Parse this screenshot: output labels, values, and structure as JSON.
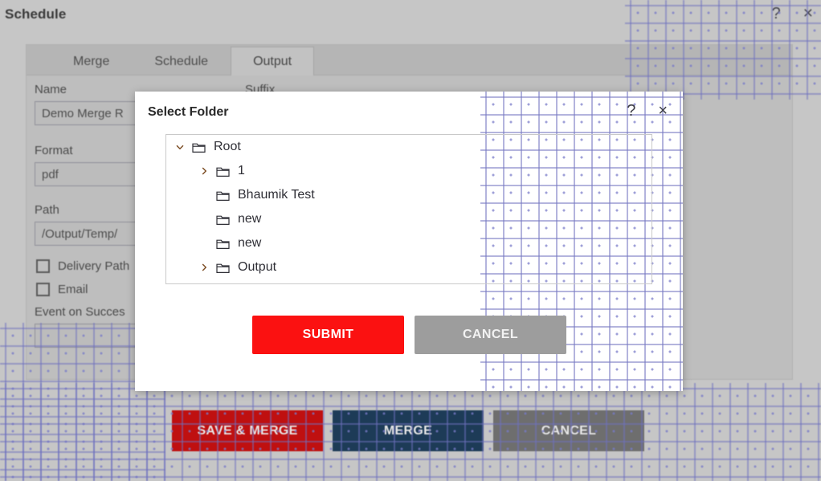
{
  "window": {
    "title": "Schedule",
    "help_icon": "?",
    "close_icon": "×"
  },
  "tabs": [
    {
      "label": "Merge",
      "active": false
    },
    {
      "label": "Schedule",
      "active": false
    },
    {
      "label": "Output",
      "active": true
    }
  ],
  "form": {
    "name_label": "Name",
    "name_value": "Demo Merge R",
    "suffix_label": "Suffix",
    "format_label": "Format",
    "format_value": "pdf",
    "path_label": "Path",
    "path_value": "/Output/Temp/",
    "delivery_path_label": "Delivery Path",
    "email_label": "Email",
    "event_on_success_label": "Event on Succes",
    "event_on_success_value": ""
  },
  "bottom_actions": [
    {
      "label": "SAVE & MERGE",
      "color": "#bf1010"
    },
    {
      "label": "MERGE",
      "color": "#1d3b57"
    },
    {
      "label": "CANCEL",
      "color": "#6e6e6e"
    }
  ],
  "modal": {
    "title": "Select Folder",
    "help_icon": "?",
    "close_icon": "×",
    "tree": [
      {
        "label": "Root",
        "depth": 0,
        "expanded": true,
        "has_children": true
      },
      {
        "label": "1",
        "depth": 1,
        "expanded": false,
        "has_children": true
      },
      {
        "label": "Bhaumik Test",
        "depth": 1,
        "expanded": false,
        "has_children": false
      },
      {
        "label": "new",
        "depth": 1,
        "expanded": false,
        "has_children": false
      },
      {
        "label": "new",
        "depth": 1,
        "expanded": false,
        "has_children": false
      },
      {
        "label": "Output",
        "depth": 1,
        "expanded": false,
        "has_children": true
      }
    ],
    "buttons": [
      {
        "label": "SUBMIT",
        "style": "submit",
        "color": "#fb1111"
      },
      {
        "label": "CANCEL",
        "style": "cancel",
        "color": "#9d9d9d"
      }
    ]
  }
}
